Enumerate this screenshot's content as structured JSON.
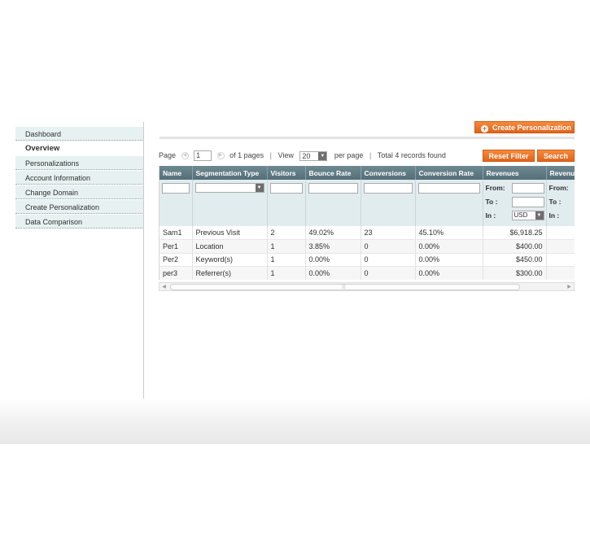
{
  "sidebar": {
    "items": [
      {
        "label": "Dashboard"
      },
      {
        "label": "Overview"
      },
      {
        "label": "Personalizations"
      },
      {
        "label": "Account Information"
      },
      {
        "label": "Change Domain"
      },
      {
        "label": "Create Personalization"
      },
      {
        "label": "Data Comparison"
      }
    ],
    "active_index": 1
  },
  "header": {
    "create_button": "Create Personalization",
    "create_icon": "plus-circle-icon"
  },
  "pager": {
    "page_label": "Page",
    "page_value": "1",
    "of_pages": "of 1 pages",
    "view_label": "View",
    "per_page_value": "20",
    "per_page_label": "per page",
    "total": "Total 4 records found"
  },
  "actions": {
    "reset": "Reset Filter",
    "search": "Search"
  },
  "grid": {
    "columns": [
      "Name",
      "Segmentation Type",
      "Visitors",
      "Bounce Rate",
      "Conversions",
      "Conversion Rate",
      "Revenues",
      "Revenue"
    ],
    "filter": {
      "from": "From:",
      "to": "To :",
      "in": "In :",
      "currency": "USD"
    },
    "rows": [
      [
        "Sam1",
        "Previous Visit",
        "2",
        "49.02%",
        "23",
        "45.10%",
        "$6,918.25"
      ],
      [
        "Per1",
        "Location",
        "1",
        "3.85%",
        "0",
        "0.00%",
        "$400.00"
      ],
      [
        "Per2",
        "Keyword(s)",
        "1",
        "0.00%",
        "0",
        "0.00%",
        "$450.00"
      ],
      [
        "per3",
        "Referrer(s)",
        "1",
        "0.00%",
        "0",
        "0.00%",
        "$300.00"
      ]
    ]
  },
  "colors": {
    "accent": "#e0631a",
    "header_bg": "#607a84",
    "filter_bg": "#e1ecef",
    "sidebar_bg": "#e7f1f1"
  }
}
